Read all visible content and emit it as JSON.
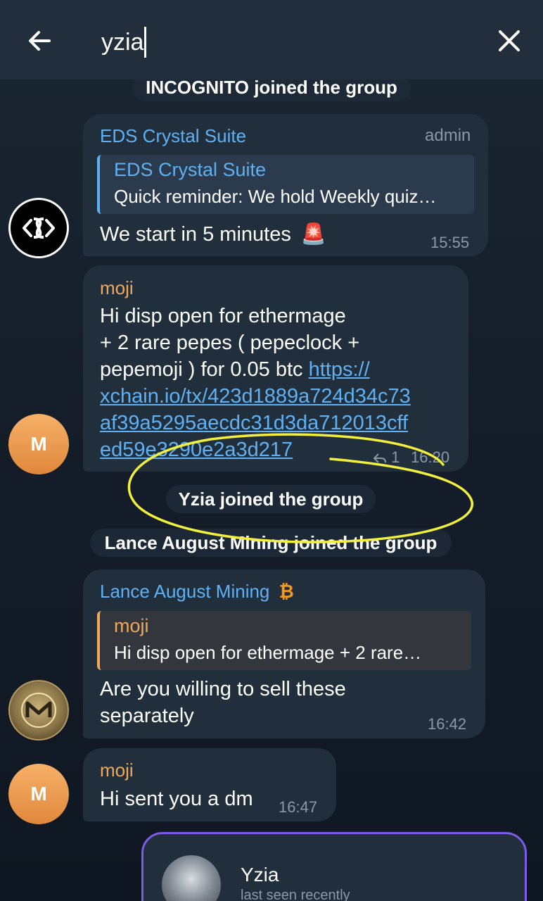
{
  "search": {
    "query": "yzia"
  },
  "icons": {
    "back": "arrow-left-icon",
    "close": "close-icon"
  },
  "colors": {
    "accent": "#5fb1f3",
    "sender_orange": "#f0a85a",
    "popup_border": "#7b5ce8",
    "annotation": "#f2f03a"
  },
  "service": {
    "incognito": "INCOGNITO joined the group",
    "yzia": "Yzia joined the group",
    "lance": "Lance August Mining joined the group"
  },
  "messages": [
    {
      "sender": "EDS Crystal Suite",
      "role": "admin",
      "reply_name": "EDS Crystal Suite",
      "reply_text": "Quick reminder:  We hold Weekly quiz…",
      "text": "We start in 5 minutes",
      "emoji": "🚨",
      "time": "15:55"
    },
    {
      "sender": "moji",
      "lines": [
        "Hi    disp open for ethermage",
        "+ 2 rare pepes ( pepeclock +",
        "pepemoji ) for 0.05 btc "
      ],
      "link_first": "https://",
      "link_lines": [
        "xchain.io/tx/423d1889a724d34c73",
        "af39a5295aecdc31d3da712013cff",
        "ed59e3290e2a3d217"
      ],
      "forwards": "1",
      "time": "16:20",
      "avatar_letter": "M"
    },
    {
      "sender": "Lance August Mining",
      "sender_badge": "₿",
      "reply_name": "moji",
      "reply_text": "Hi    disp open for ethermage + 2 rare…",
      "lines": [
        "Are you willing to sell these",
        "separately"
      ],
      "time": "16:42"
    },
    {
      "sender": "moji",
      "text": "Hi sent you a dm",
      "time": "16:47",
      "avatar_letter": "M"
    }
  ],
  "popup": {
    "name": "Yzia",
    "status": "last seen recently"
  }
}
